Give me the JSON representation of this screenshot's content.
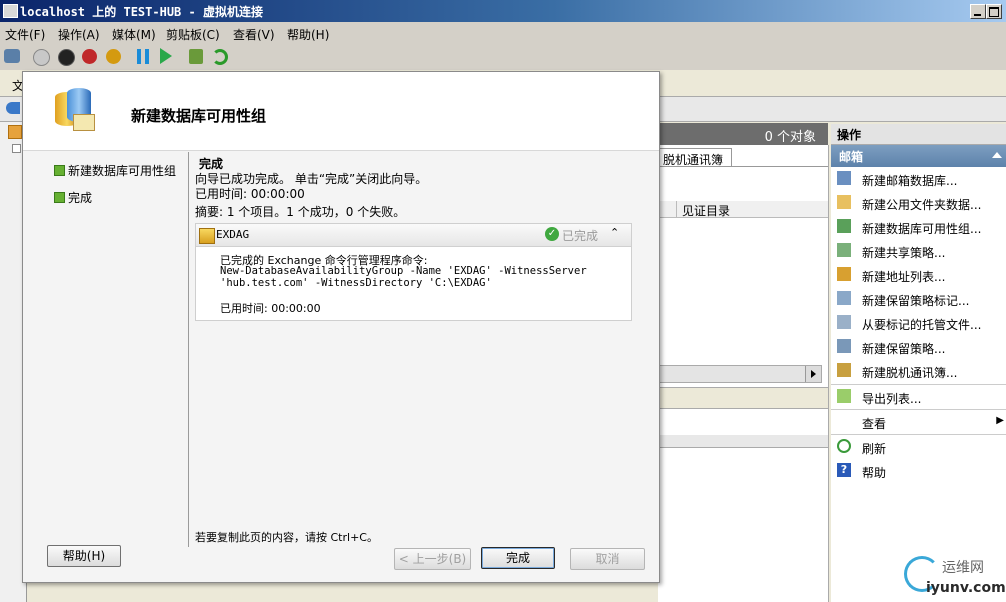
{
  "window": {
    "title": "localhost 上的 TEST-HUB - 虚拟机连接"
  },
  "menubar": [
    "文件(F)",
    "操作(A)",
    "媒体(M)",
    "剪贴板(C)",
    "查看(V)",
    "帮助(H)"
  ],
  "toolbar": {
    "icons": [
      "ctrl-alt-del-icon",
      "start-icon",
      "turn-off-icon",
      "shutdown-icon",
      "power-icon",
      "pause-icon",
      "resume-icon",
      "snapshot-icon",
      "revert-icon"
    ]
  },
  "background": {
    "file_menu_fragment": "文",
    "objects_count": "0 个对象",
    "tab_label": "脱机通讯簿",
    "column_header": "见证目录",
    "actions_header": "操作",
    "actions_subheader": "邮箱",
    "actions": [
      "新建邮箱数据库...",
      "新建公用文件夹数据...",
      "新建数据库可用性组...",
      "新建共享策略...",
      "新建地址列表...",
      "新建保留策略标记...",
      "从要标记的托管文件...",
      "新建保留策略...",
      "新建脱机通讯簿...",
      "导出列表...",
      "查看",
      "刷新",
      "帮助"
    ]
  },
  "wizard": {
    "title": "新建数据库可用性组",
    "steps": [
      "新建数据库可用性组",
      "完成"
    ],
    "content": {
      "heading": "完成",
      "line1": "向导已成功完成。 单击“完成”关闭此向导。",
      "elapsed": "已用时间: 00:00:00",
      "summary": "摘要: 1 个项目。1 个成功，0 个失败。",
      "item_name": "EXDAG",
      "item_status": "已完成",
      "cmd_label": "已完成的 Exchange 命令行管理程序命令:",
      "cmd_line1": "New-DatabaseAvailabilityGroup -Name 'EXDAG' -WitnessServer",
      "cmd_line2": "'hub.test.com' -WitnessDirectory 'C:\\EXDAG'",
      "item_elapsed": "已用时间: 00:00:00",
      "copy_hint": "若要复制此页的内容，请按 Ctrl+C。"
    },
    "buttons": {
      "help": "帮助(H)",
      "back": "< 上一步(B)",
      "finish": "完成",
      "cancel": "取消"
    }
  },
  "watermark": {
    "cn": "运维网",
    "url": "iyunv.com"
  }
}
